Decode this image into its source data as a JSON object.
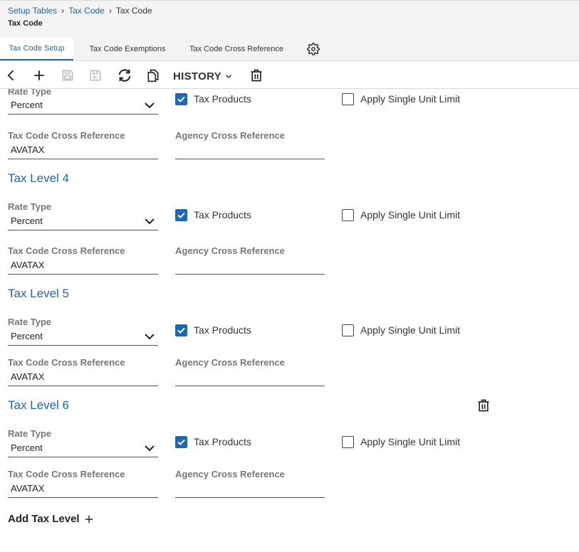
{
  "breadcrumb": {
    "items": [
      "Setup Tables",
      "Tax Code"
    ],
    "current": "Tax Code"
  },
  "page_title": "Tax Code",
  "tabs": [
    {
      "label": "Tax Code Setup",
      "active": true
    },
    {
      "label": "Tax Code Exemptions",
      "active": false
    },
    {
      "label": "Tax Code Cross Reference",
      "active": false
    }
  ],
  "toolbar": {
    "history_label": "HISTORY"
  },
  "fields": {
    "rate_type_label": "Rate Type",
    "tax_products_label": "Tax Products",
    "apply_single_unit_limit_label": "Apply Single Unit Limit",
    "tax_code_cross_reference_label": "Tax Code Cross Reference",
    "agency_cross_reference_label": "Agency Cross Reference"
  },
  "levels": [
    {
      "title": "",
      "rate_type": "Percent",
      "tax_products": true,
      "apply_single_unit_limit": false,
      "tax_code_cross_reference": "AVATAX",
      "agency_cross_reference": ""
    },
    {
      "title": "Tax Level 4",
      "rate_type": "Percent",
      "tax_products": true,
      "apply_single_unit_limit": false,
      "tax_code_cross_reference": "AVATAX",
      "agency_cross_reference": ""
    },
    {
      "title": "Tax Level 5",
      "rate_type": "Percent",
      "tax_products": true,
      "apply_single_unit_limit": false,
      "tax_code_cross_reference": "AVATAX",
      "agency_cross_reference": ""
    },
    {
      "title": "Tax Level 6",
      "rate_type": "Percent",
      "tax_products": true,
      "apply_single_unit_limit": false,
      "tax_code_cross_reference": "AVATAX",
      "agency_cross_reference": "",
      "deletable": true
    }
  ],
  "add_tax_level_label": "Add Tax Level",
  "colors": {
    "accent": "#1f66b3",
    "header_bg": "#f3f3f3"
  }
}
